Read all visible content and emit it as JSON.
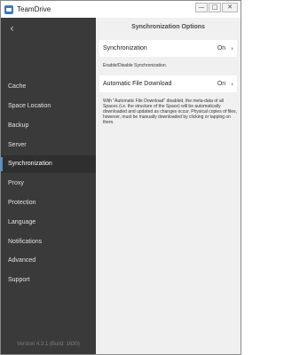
{
  "window": {
    "title": "TeamDrive",
    "controls": [
      "—",
      "□",
      "✕"
    ]
  },
  "sidebar": {
    "back_glyph": "‹",
    "items": [
      {
        "label": "Cache"
      },
      {
        "label": "Space Location"
      },
      {
        "label": "Backup"
      },
      {
        "label": "Server"
      },
      {
        "label": "Synchronization"
      },
      {
        "label": "Proxy"
      },
      {
        "label": "Protection"
      },
      {
        "label": "Language"
      },
      {
        "label": "Notifications"
      },
      {
        "label": "Advanced"
      },
      {
        "label": "Support"
      }
    ],
    "active_item": "Synchronization",
    "version": "Version 4.3.1 (Build: 1630)"
  },
  "main": {
    "title": "Synchronization Options",
    "options": [
      {
        "label": "Synchronization",
        "value": "On",
        "description": "Enable/Disable Synchronization."
      },
      {
        "label": "Automatic File Download",
        "value": "On",
        "description": "With \"Automatic File Download\" disabled, the meta-data of all Spaces (i.e. the structure of the Space) will be automatically downloaded and updated as changes occur. Physical copies of files, however, must be manually downloaded by clicking or tapping on them."
      }
    ]
  },
  "colors": {
    "sidebar_bg": "#3a3a3a",
    "content_bg": "#f0f0f0",
    "accent": "#4a90d9"
  }
}
